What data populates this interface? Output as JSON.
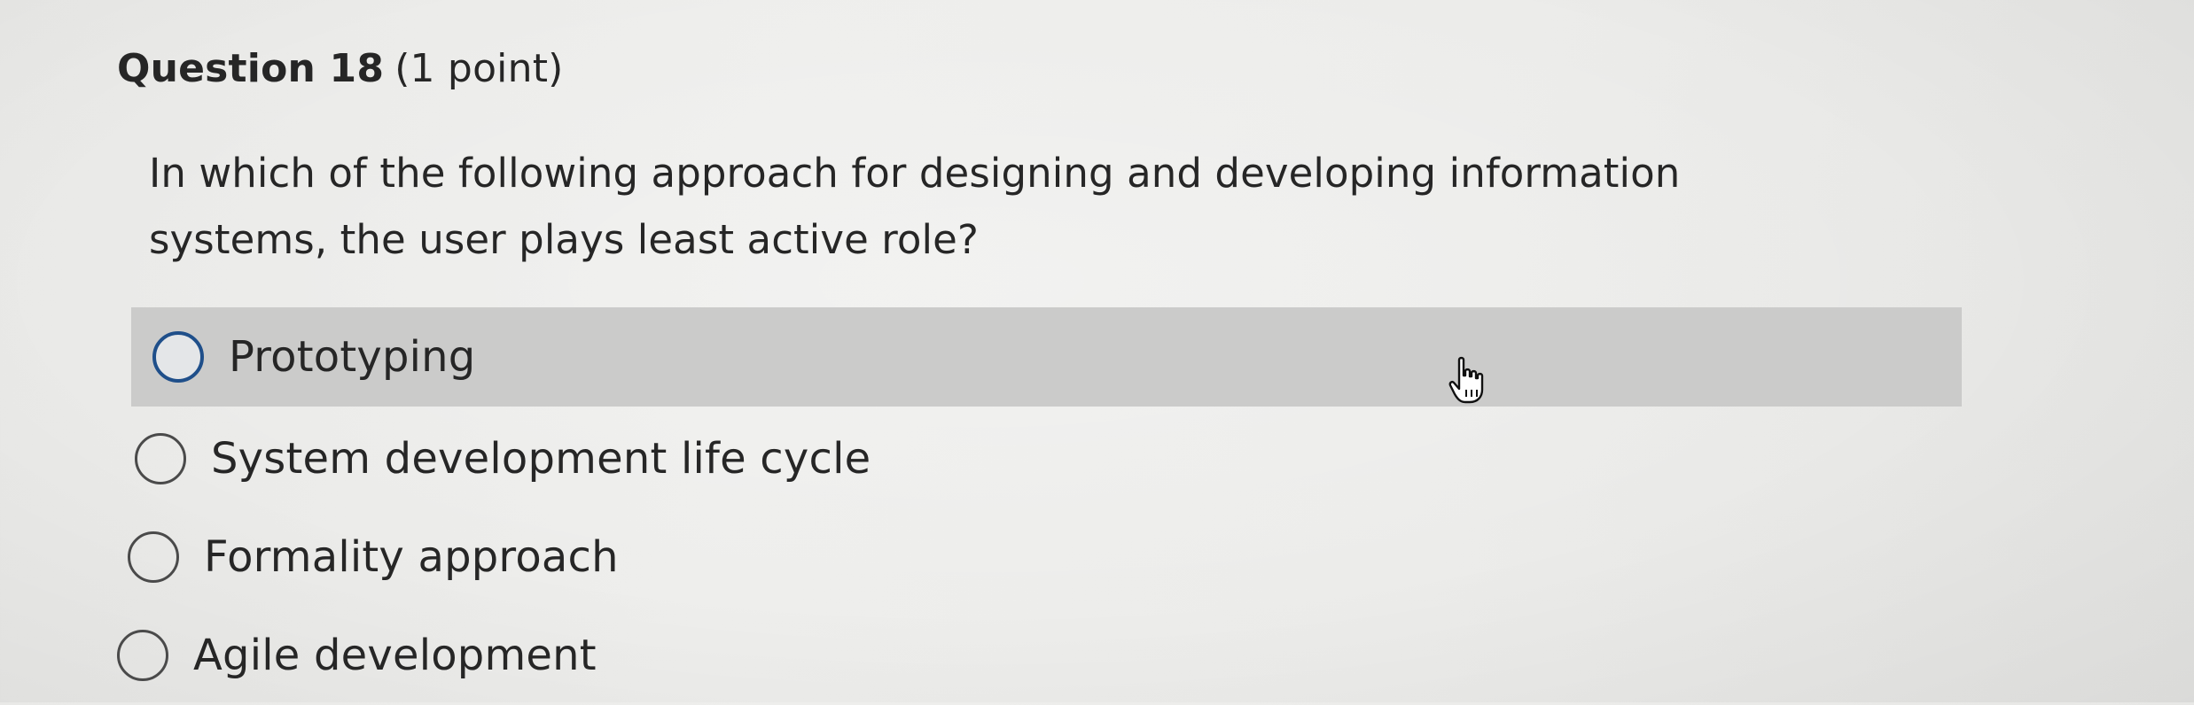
{
  "question": {
    "number_label": "Question 18",
    "points_label": "(1 point)",
    "text": "In which of the following approach for designing and developing information systems, the user plays least active role?"
  },
  "options": [
    {
      "label": "Prototyping",
      "hovered": true
    },
    {
      "label": "System development life cycle",
      "hovered": false
    },
    {
      "label": "Formality approach",
      "hovered": false
    },
    {
      "label": "Agile development",
      "hovered": false
    }
  ],
  "cursor": {
    "icon": "hand-pointer-icon"
  },
  "colors": {
    "background": "#ecece9",
    "hover_row": "#cbcbca",
    "radio_focus": "#1f4f8a",
    "text": "#262626"
  }
}
